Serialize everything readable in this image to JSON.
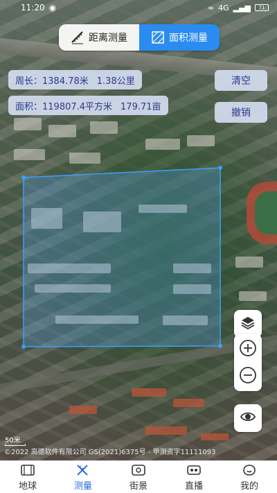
{
  "status_bar": {
    "time": "11:20",
    "right_text": "4G",
    "battery": "71"
  },
  "mode_toggle": {
    "distance_label": "距离测量",
    "area_label": "面积测量",
    "active": "area"
  },
  "measurement": {
    "perimeter_label": "周长：1384.78米",
    "perimeter_km": "1.38公里",
    "area_label": "面积：119807.4平方米",
    "area_mu": "179.71亩"
  },
  "actions": {
    "clear_label": "清空",
    "undo_label": "撤销"
  },
  "map": {
    "scale_label": "50米",
    "copyright": "©2022 高德软件有限公司 GS(2021)6375号 - 甲测资字11111093",
    "polygon_color": "#3aa0ff"
  },
  "bottom_nav": {
    "items": [
      {
        "label": "地球",
        "icon": "earth-icon"
      },
      {
        "label": "测量",
        "icon": "measure-icon"
      },
      {
        "label": "街景",
        "icon": "streetview-icon"
      },
      {
        "label": "直播",
        "icon": "live-icon"
      },
      {
        "label": "我的",
        "icon": "profile-icon"
      }
    ],
    "active_index": 1,
    "active_color": "#2a6fdb"
  }
}
